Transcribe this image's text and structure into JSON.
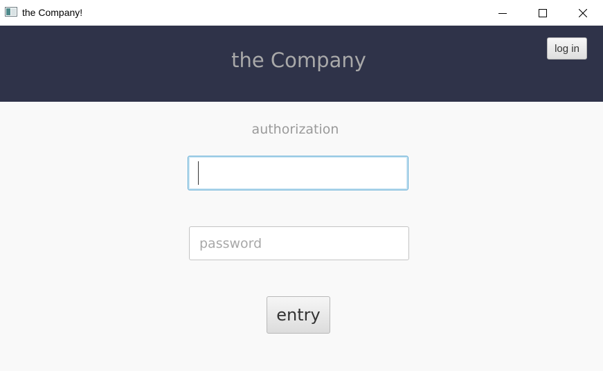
{
  "window": {
    "title": "the Company!",
    "icon": "java-app-icon",
    "controls": [
      "minimize-icon",
      "maximize-icon",
      "close-icon"
    ]
  },
  "header": {
    "title": "the Company",
    "login_button_label": "log in",
    "background_color": "#2f3349"
  },
  "form": {
    "heading": "authorization",
    "login_field": {
      "value": "",
      "placeholder": ""
    },
    "password_field": {
      "value": "",
      "placeholder": "password"
    },
    "submit_label": "entry"
  },
  "colors": {
    "focus_border": "#5aa9d4",
    "page_background": "#f9f9f9"
  }
}
